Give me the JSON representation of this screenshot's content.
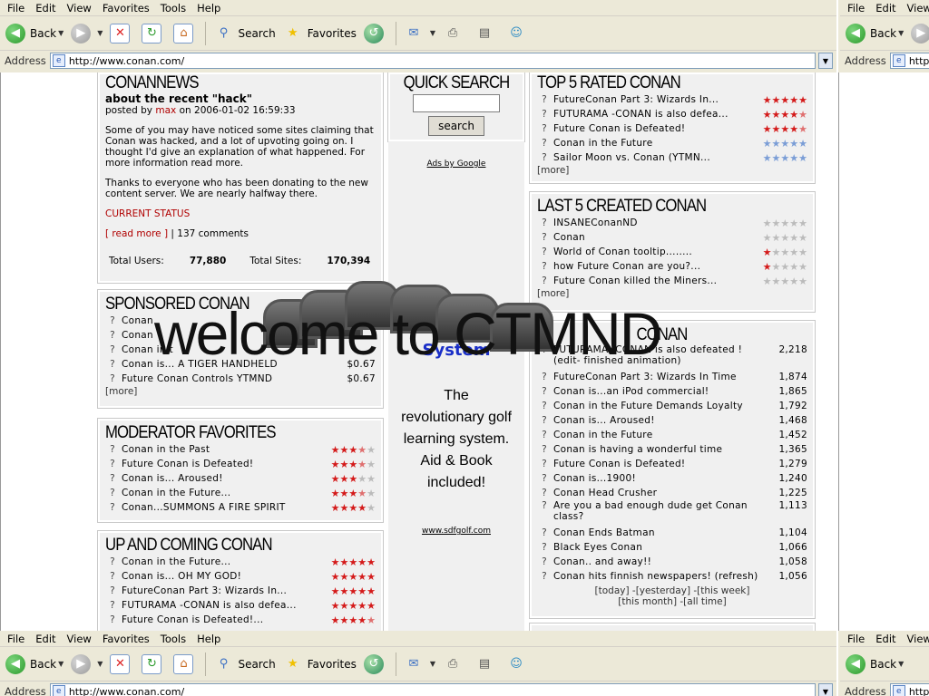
{
  "browser": {
    "menu": [
      "File",
      "Edit",
      "View",
      "Favorites",
      "Tools",
      "Help"
    ],
    "toolbar": {
      "back": "Back",
      "search": "Search",
      "favorites": "Favorites"
    },
    "address_label": "Address",
    "url": "http://www.conan.com/",
    "mirror_menu": [
      "File",
      "Edit",
      "View"
    ],
    "mirror_back": "Back",
    "mirror_address_label": "Address",
    "mirror_url": "http://"
  },
  "news": {
    "title": "CONANNEWS",
    "headline": "about the recent \"hack\"",
    "posted_by_prefix": "posted by",
    "author": "max",
    "posted_on": "on 2006-01-02 16:59:33",
    "para1": "Some of you may have noticed some sites claiming that Conan was hacked, and a lot of upvoting going on. I thought I'd give an explanation of what happened. For more information read more.",
    "para2": "Thanks to everyone who has been donating to the new content server. We are nearly halfway there.",
    "status": "CURRENT STATUS",
    "read_more": "[ read more ]",
    "comments": "| 137 comments",
    "total_users_label": "Total Users:",
    "total_users": "77,880",
    "total_sites_label": "Total Sites:",
    "total_sites": "170,394"
  },
  "quick_search": {
    "title": "QUICK SEARCH",
    "button": "search"
  },
  "ads": {
    "label": "Ads by Google",
    "system": "System",
    "description": "The revolutionary golf learning system. Aid & Book included!",
    "url": "www.sdfgolf.com"
  },
  "overlay_text": "welcome to CTMND",
  "sponsored": {
    "title": "SPONSORED CONAN",
    "items": [
      {
        "q": "?",
        "title": "Conan",
        "price": ""
      },
      {
        "q": "?",
        "title": "Conan",
        "price": ""
      },
      {
        "q": "?",
        "title": "Conan in t",
        "price": ""
      },
      {
        "q": "?",
        "title": "Conan is... A TIGER HANDHELD",
        "price": "$0.67"
      },
      {
        "q": "?",
        "title": "Future Conan Controls YTMND",
        "price": "$0.67"
      }
    ],
    "more": "[more]"
  },
  "moderator": {
    "title": "MODERATOR FAVORITES",
    "items": [
      {
        "q": "?",
        "title": "Conan in the Past",
        "rating": 3.5
      },
      {
        "q": "?",
        "title": "Future Conan is Defeated!",
        "rating": 3.5
      },
      {
        "q": "?",
        "title": "Conan is... Aroused!",
        "rating": 3
      },
      {
        "q": "?",
        "title": "Conan in the Future...",
        "rating": 3.5
      },
      {
        "q": "?",
        "title": "Conan...SUMMONS A FIRE SPIRIT",
        "rating": 4
      }
    ]
  },
  "upcoming": {
    "title": "UP AND COMING CONAN",
    "items": [
      {
        "q": "?",
        "title": "Conan in the Future...",
        "rating": 5
      },
      {
        "q": "?",
        "title": "Conan is... OH MY GOD!",
        "rating": 5
      },
      {
        "q": "?",
        "title": "FutureConan Part 3: Wizards In...",
        "rating": 5
      },
      {
        "q": "?",
        "title": "FUTURAMA -CONAN is also defea...",
        "rating": 5
      },
      {
        "q": "?",
        "title": "Future Conan is Defeated!...",
        "rating": 4.5
      }
    ]
  },
  "top5": {
    "title": "TOP 5 RATED CONAN",
    "items": [
      {
        "q": "?",
        "title": "FutureConan Part 3: Wizards In...",
        "rating": 5,
        "color": "#d41a1a"
      },
      {
        "q": "?",
        "title": "FUTURAMA -CONAN is also defea...",
        "rating": 4.5,
        "color": "#d41a1a"
      },
      {
        "q": "?",
        "title": "Future Conan is Defeated!",
        "rating": 4.5,
        "color": "#d41a1a"
      },
      {
        "q": "?",
        "title": "Conan in the Future",
        "rating": 5,
        "color": "#7a9dd6"
      },
      {
        "q": "?",
        "title": "Sailor Moon vs. Conan  (YTMN...",
        "rating": 5,
        "color": "#7a9dd6"
      }
    ],
    "more": "[more]"
  },
  "last5": {
    "title": "LAST 5 CREATED CONAN",
    "items": [
      {
        "q": "?",
        "title": "INSANEConanND",
        "rating": 0
      },
      {
        "q": "?",
        "title": "Conan",
        "rating": 0
      },
      {
        "q": "?",
        "title": "World of Conan tooltip........",
        "rating": 1
      },
      {
        "q": "?",
        "title": "how Future Conan are you?...",
        "rating": 1
      },
      {
        "q": "?",
        "title": "Future Conan killed the Miners...",
        "rating": 0
      }
    ],
    "more": "[more]"
  },
  "popular": {
    "title": "CONAN",
    "items": [
      {
        "q": "?",
        "title": "FUTURAMA -CONAN is also defeated ! (edit- finished animation)",
        "count": "2,218"
      },
      {
        "q": "?",
        "title": "FutureConan Part 3: Wizards In Time",
        "count": "1,874"
      },
      {
        "q": "?",
        "title": "Conan is...an iPod commercial!",
        "count": "1,865"
      },
      {
        "q": "?",
        "title": "Conan in the Future Demands Loyalty",
        "count": "1,792"
      },
      {
        "q": "?",
        "title": "Conan is... Aroused!",
        "count": "1,468"
      },
      {
        "q": "?",
        "title": "Conan in the Future",
        "count": "1,452"
      },
      {
        "q": "?",
        "title": "Conan is having a wonderful time",
        "count": "1,365"
      },
      {
        "q": "?",
        "title": "Future Conan is Defeated!",
        "count": "1,279"
      },
      {
        "q": "?",
        "title": "Conan is...1900!",
        "count": "1,240"
      },
      {
        "q": "?",
        "title": "Conan Head Crusher",
        "count": "1,225"
      },
      {
        "q": "?",
        "title": "Are you a bad enough dude get Conan class?",
        "count": "1,113"
      },
      {
        "q": "?",
        "title": "Conan Ends Batman",
        "count": "1,104"
      },
      {
        "q": "?",
        "title": "Black Eyes Conan",
        "count": "1,066"
      },
      {
        "q": "?",
        "title": "Conan.. and away!!",
        "count": "1,058"
      },
      {
        "q": "?",
        "title": "Conan hits finnish newspapers! (refresh)",
        "count": "1,056"
      }
    ],
    "periods_line1": "[today] -[yesterday] -[this week]",
    "periods_line2": "[this month] -[all time]"
  },
  "colors": {
    "star_red": "#d41a1a",
    "star_blue": "#7a9dd6",
    "star_off": "#bbbbbb",
    "link_red": "#b00000",
    "ad_blue": "#1a2fc8"
  }
}
